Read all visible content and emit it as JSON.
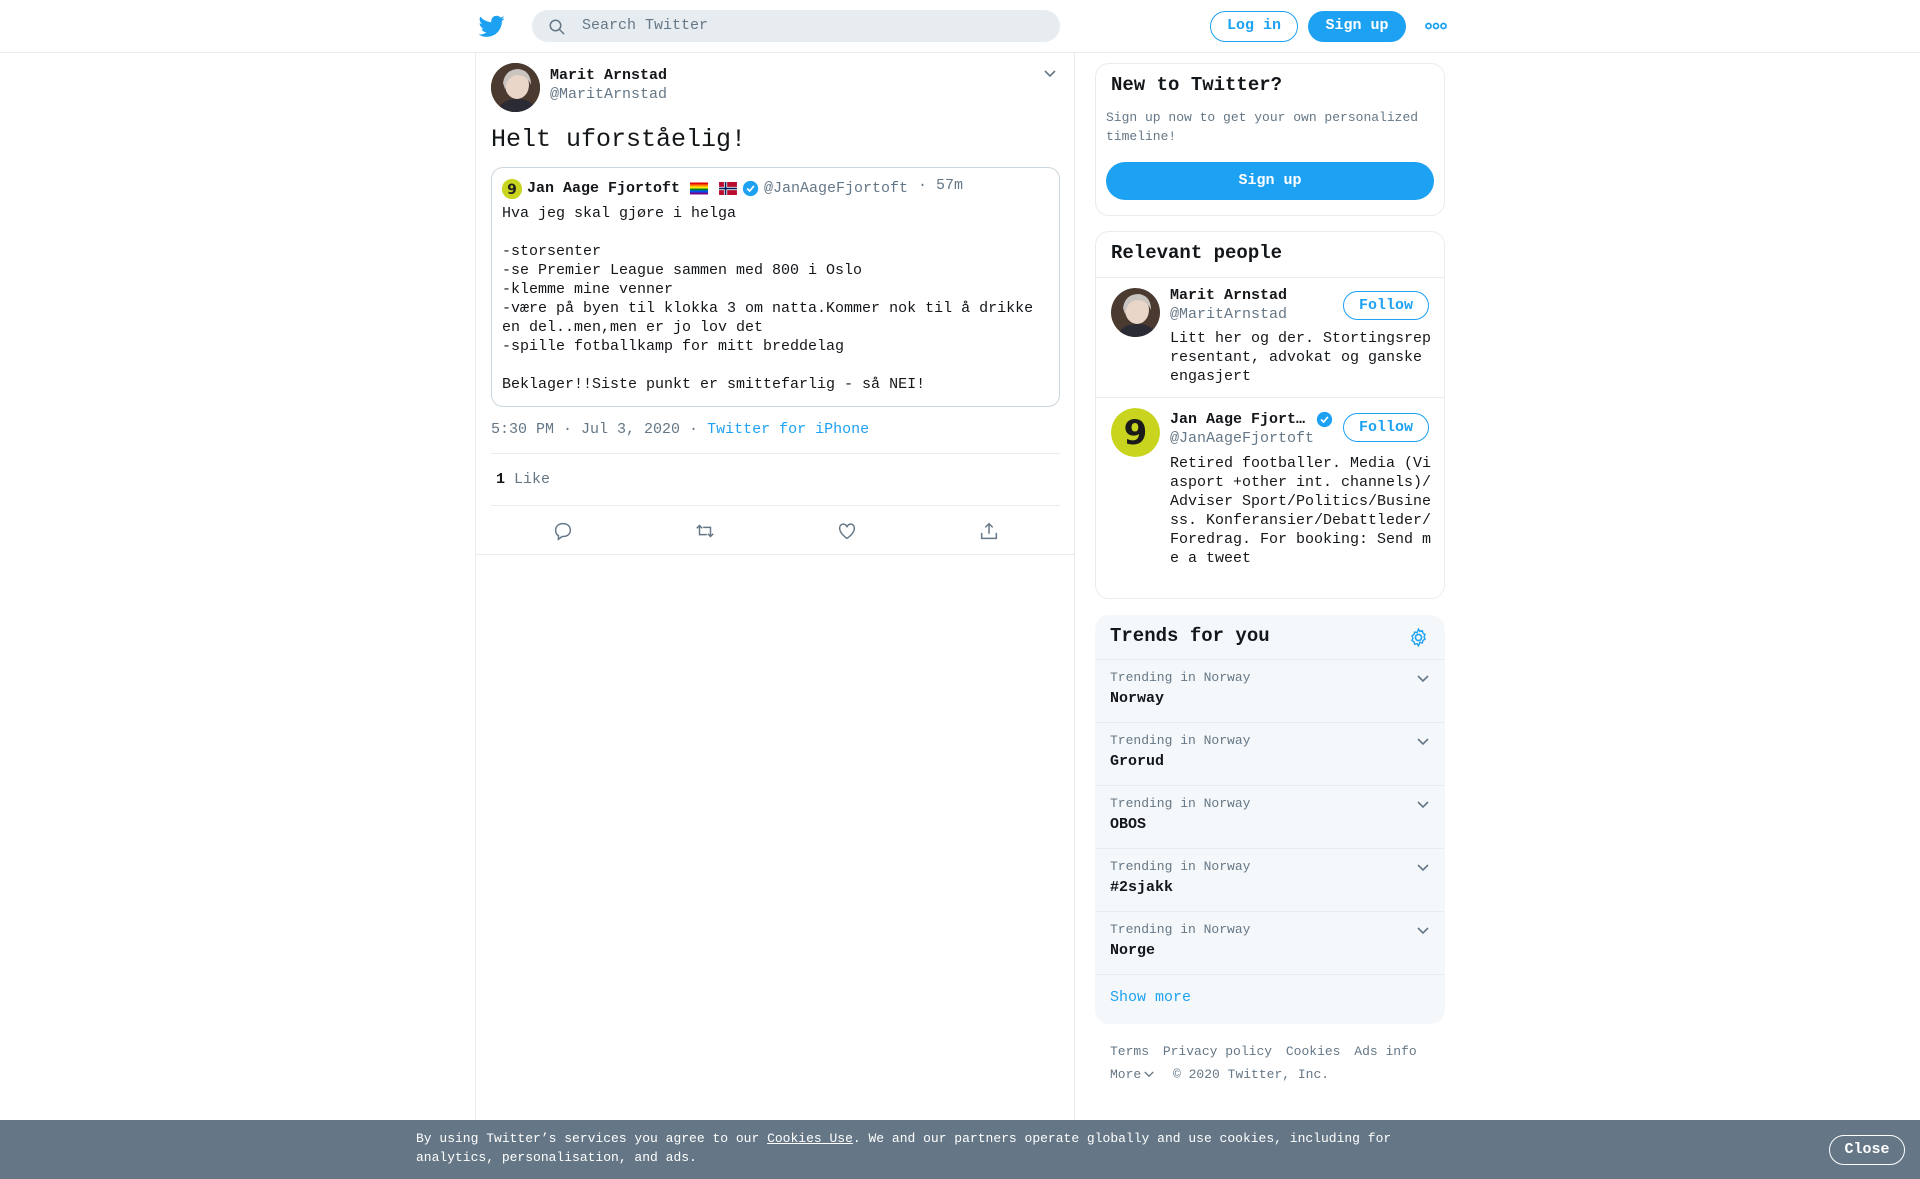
{
  "header": {
    "search_placeholder": "Search Twitter",
    "login_label": "Log in",
    "signup_label": "Sign up",
    "logo_icon": "twitter-bird-icon",
    "more_icon": "more-dots-icon"
  },
  "tweet": {
    "author_name": "Marit Arnstad",
    "author_handle": "@MaritArnstad",
    "text": "Helt uforståelig!",
    "quoted": {
      "author_name": "Jan Aage Fjortoft",
      "author_handle": "@JanAageFjortoft",
      "time": "· 57m",
      "body": "Hva jeg skal gjøre i helga\n\n-storsenter\n-se Premier League sammen med 800 i Oslo\n-klemme mine venner\n-være på byen til klokka 3 om natta.Kommer nok til å drikke en del..men,men er jo lov det\n-spille fotballkamp for mitt breddelag\n\nBeklager!!Siste punkt er smittefarlig - så NEI!"
    },
    "timestamp": "5:30 PM · Jul 3, 2020",
    "source_sep": "·",
    "source": "Twitter for iPhone",
    "like_count": "1",
    "like_label": "Like"
  },
  "sidebar": {
    "new_to_twitter": {
      "title": "New to Twitter?",
      "text": "Sign up now to get your own personalized timeline!",
      "signup_label": "Sign up"
    },
    "relevant_people": {
      "title": "Relevant people",
      "people": [
        {
          "name": "Marit Arnstad",
          "handle": "@MaritArnstad",
          "follow_label": "Follow",
          "bio": "Litt her og der. Stortingsrepresentant, advokat og ganske engasjert"
        },
        {
          "name": "Jan Aage Fjort…",
          "handle": "@JanAageFjortoft",
          "follow_label": "Follow",
          "bio": "Retired footballer. Media (Viasport +other int. channels)/ Adviser Sport/Politics/Business. Konferansier/Debattleder/Foredrag. For booking: Send me a tweet"
        }
      ]
    },
    "trends": {
      "title": "Trends for you",
      "items": [
        {
          "category": "Trending in Norway",
          "name": "Norway"
        },
        {
          "category": "Trending in Norway",
          "name": "Grorud"
        },
        {
          "category": "Trending in Norway",
          "name": "OBOS"
        },
        {
          "category": "Trending in Norway",
          "name": "#2sjakk"
        },
        {
          "category": "Trending in Norway",
          "name": "Norge"
        }
      ],
      "show_more": "Show more"
    },
    "footer": {
      "links": [
        "Terms",
        "Privacy policy",
        "Cookies",
        "Ads info"
      ],
      "more_label": "More",
      "copyright": "© 2020 Twitter, Inc."
    }
  },
  "cookie_bar": {
    "text_before": "By using Twitter’s services you agree to our ",
    "link": "Cookies Use",
    "text_after": ". We and our partners operate globally and use cookies, including for analytics, personalisation, and ads.",
    "close_label": "Close"
  },
  "colors": {
    "accent": "#1da1f2",
    "secondary_text": "#657786",
    "border": "#e6ecf0",
    "cookie_bar_bg": "#657786"
  }
}
